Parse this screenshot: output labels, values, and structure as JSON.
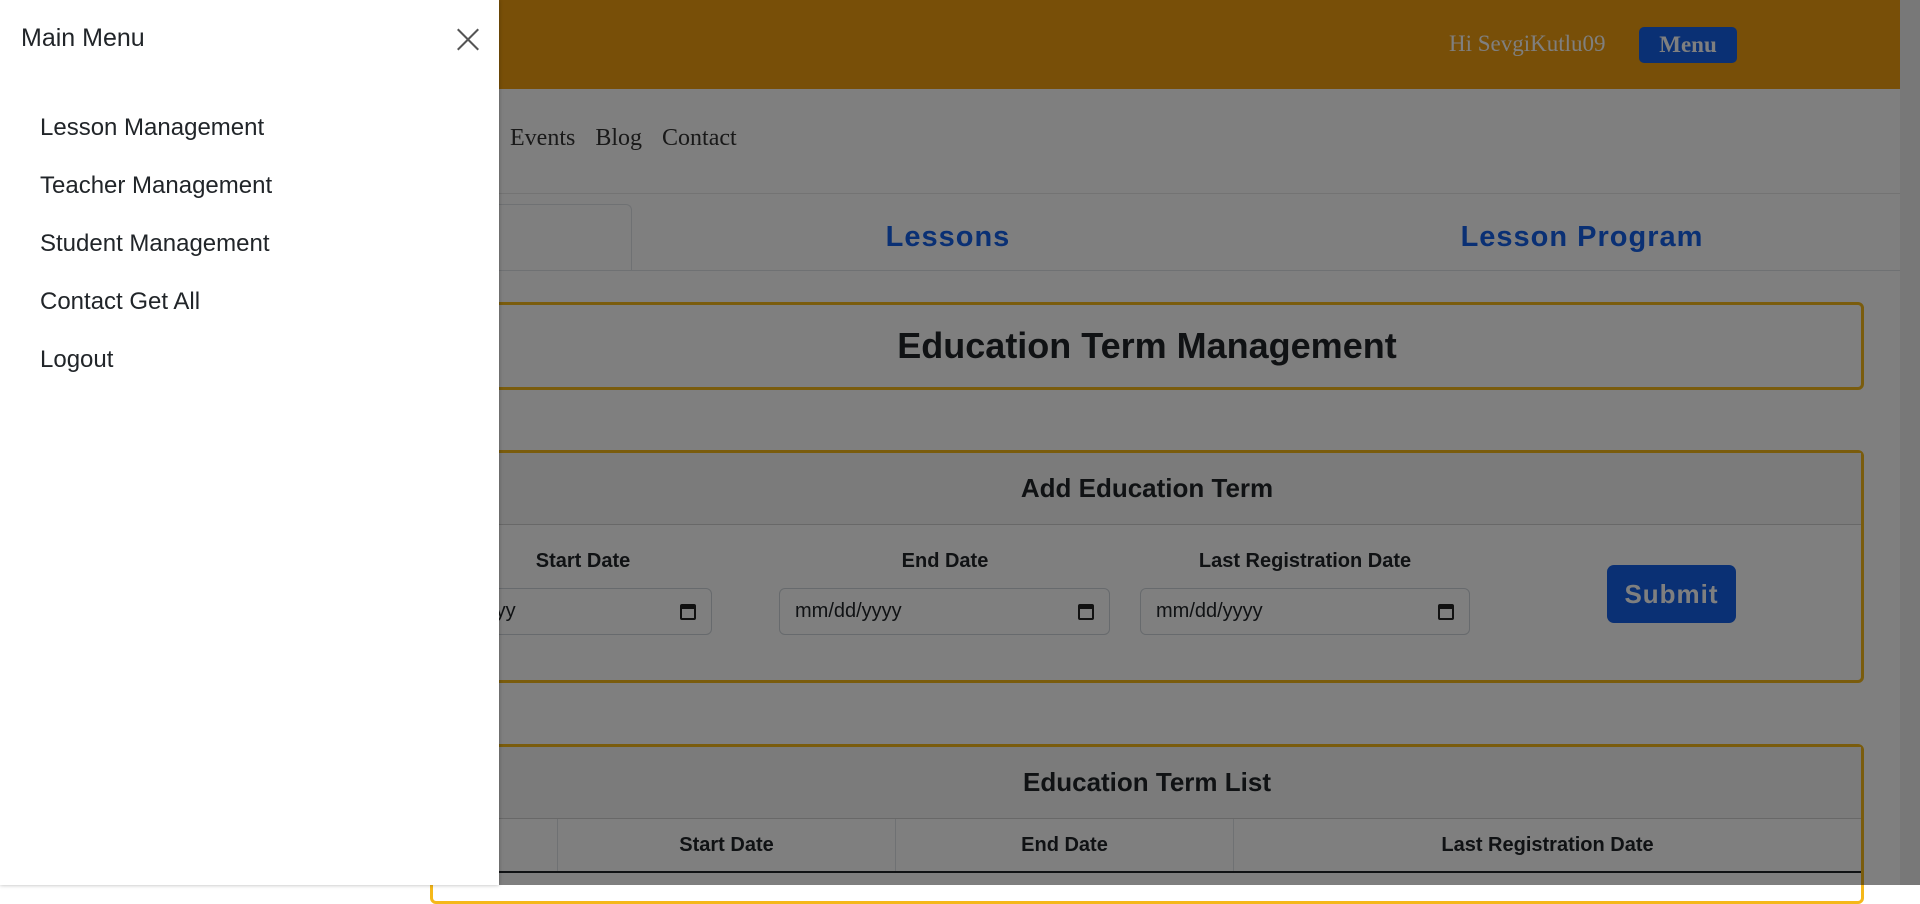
{
  "header": {
    "greeting": "Hi SevgiKutlu09",
    "menu_label": "Menu",
    "accent": "#f19e11",
    "button_color": "#1560e8"
  },
  "nav": {
    "links": [
      "Events",
      "Blog",
      "Contact"
    ]
  },
  "tabs": [
    "Lessons",
    "Lesson Program"
  ],
  "page_title": "Education Term Management",
  "add_form": {
    "title": "Add Education Term",
    "fields": [
      {
        "label": "Start Date",
        "placeholder": "mm/dd/yyyy"
      },
      {
        "label": "End Date",
        "placeholder": "mm/dd/yyyy"
      },
      {
        "label": "Last Registration Date",
        "placeholder": "mm/dd/yyyy"
      }
    ],
    "submit_label": "Submit"
  },
  "term_list": {
    "title": "Education Term List",
    "columns": [
      "Start Date",
      "End Date",
      "Last Registration Date"
    ]
  },
  "offcanvas": {
    "title": "Main Menu",
    "items": [
      "Lesson Management",
      "Teacher Management",
      "Student Management",
      "Contact Get All",
      "Logout"
    ]
  }
}
